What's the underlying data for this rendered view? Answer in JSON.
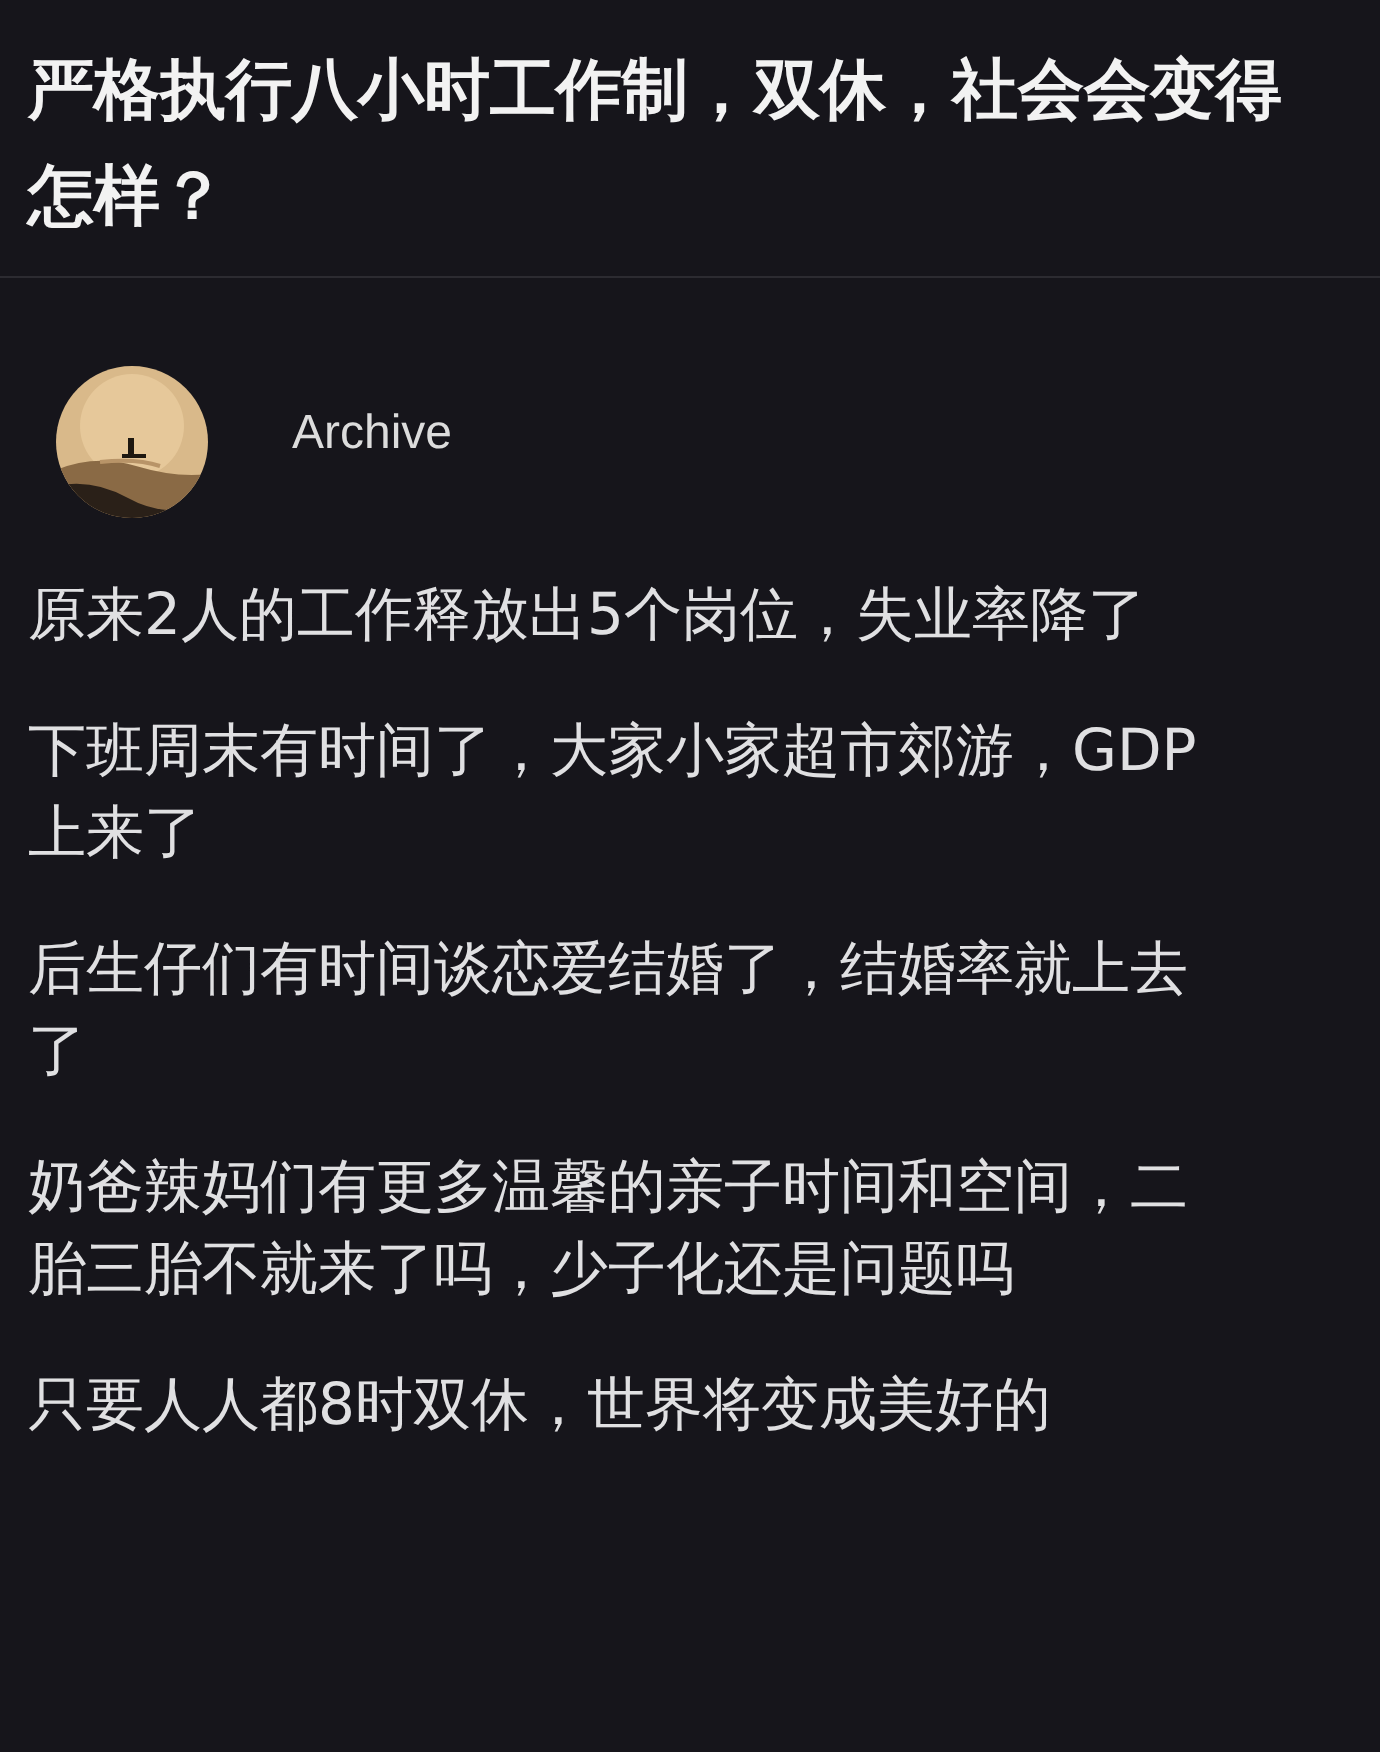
{
  "question": {
    "title": "严格执行八小时工作制，双休，社会会变得怎样？"
  },
  "answer": {
    "author": {
      "name": "Archive"
    },
    "paragraphs": [
      "原来2人的工作释放出5个岗位，失业率降了",
      "下班周末有时间了，大家小家超市郊游，GDP上来了",
      "后生仔们有时间谈恋爱结婚了，结婚率就上去了",
      "奶爸辣妈们有更多温馨的亲子时间和空间，二胎三胎不就来了吗，少子化还是问题吗",
      "只要人人都8时双休，世界将变成美好的"
    ]
  }
}
